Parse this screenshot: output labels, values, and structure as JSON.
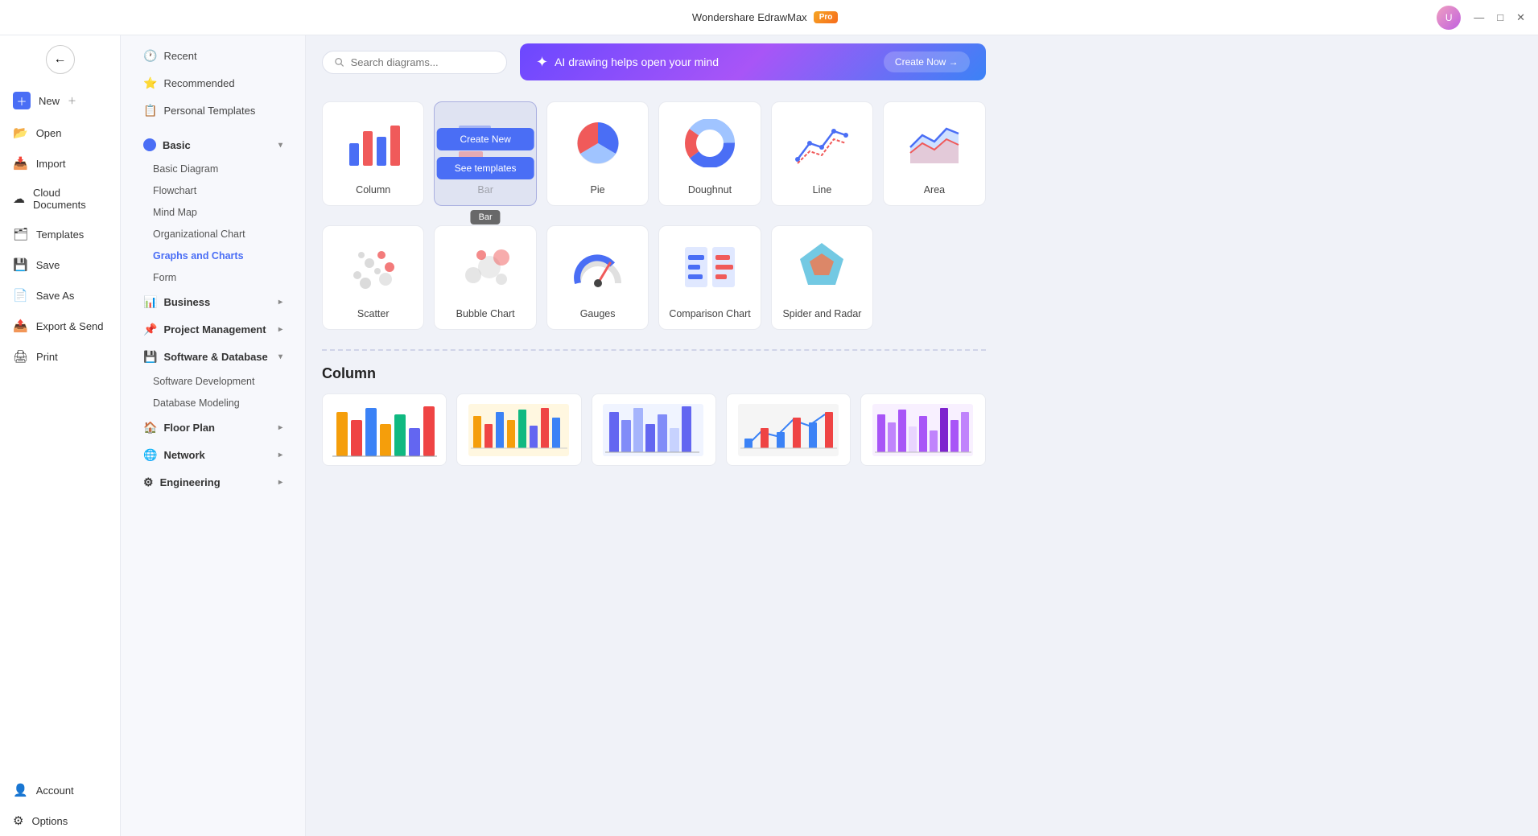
{
  "app": {
    "title": "Wondershare EdrawMax",
    "badge": "Pro"
  },
  "titlebar": {
    "minimize": "—",
    "maximize": "□",
    "close": "✕"
  },
  "search": {
    "placeholder": "Search diagrams..."
  },
  "ai_banner": {
    "icon": "✦",
    "text": "AI drawing helps open your mind",
    "button": "Create Now →"
  },
  "sidebar_narrow": {
    "items": [
      {
        "id": "new",
        "label": "New",
        "icon": "＋"
      },
      {
        "id": "open",
        "label": "Open",
        "icon": "📂"
      },
      {
        "id": "import",
        "label": "Import",
        "icon": "📥"
      },
      {
        "id": "cloud",
        "label": "Cloud Documents",
        "icon": "☁"
      },
      {
        "id": "templates",
        "label": "Templates",
        "icon": "🗂"
      },
      {
        "id": "save",
        "label": "Save",
        "icon": "💾"
      },
      {
        "id": "saveas",
        "label": "Save As",
        "icon": "📄"
      },
      {
        "id": "export",
        "label": "Export & Send",
        "icon": "📤"
      },
      {
        "id": "print",
        "label": "Print",
        "icon": "🖨"
      }
    ],
    "bottom_items": [
      {
        "id": "account",
        "label": "Account",
        "icon": "👤"
      },
      {
        "id": "options",
        "label": "Options",
        "icon": "⚙"
      }
    ]
  },
  "sidebar_wide": {
    "top_items": [
      {
        "id": "recent",
        "label": "Recent",
        "icon": "🕐"
      },
      {
        "id": "recommended",
        "label": "Recommended",
        "icon": "⭐"
      },
      {
        "id": "personal",
        "label": "Personal Templates",
        "icon": "📋"
      }
    ],
    "categories": [
      {
        "id": "basic",
        "label": "Basic",
        "expanded": true,
        "active": false,
        "subitems": [
          {
            "id": "basic-diagram",
            "label": "Basic Diagram",
            "active": false
          },
          {
            "id": "flowchart",
            "label": "Flowchart",
            "active": false
          },
          {
            "id": "mind-map",
            "label": "Mind Map",
            "active": false
          },
          {
            "id": "org-chart",
            "label": "Organizational Chart",
            "active": false
          },
          {
            "id": "graphs-charts",
            "label": "Graphs and Charts",
            "active": true
          },
          {
            "id": "form",
            "label": "Form",
            "active": false
          }
        ]
      },
      {
        "id": "business",
        "label": "Business",
        "expanded": false,
        "subitems": []
      },
      {
        "id": "project",
        "label": "Project Management",
        "expanded": false,
        "subitems": []
      },
      {
        "id": "software-db",
        "label": "Software & Database",
        "expanded": true,
        "active": false,
        "subitems": [
          {
            "id": "sw-dev",
            "label": "Software Development",
            "active": false
          },
          {
            "id": "db-modeling",
            "label": "Database Modeling",
            "active": false
          }
        ]
      },
      {
        "id": "floor-plan",
        "label": "Floor Plan",
        "expanded": false,
        "subitems": []
      },
      {
        "id": "network",
        "label": "Network",
        "expanded": false,
        "subitems": []
      },
      {
        "id": "engineering",
        "label": "Engineering",
        "expanded": false,
        "subitems": []
      }
    ]
  },
  "chart_types": [
    {
      "id": "column",
      "label": "Column",
      "hovered": false
    },
    {
      "id": "bar",
      "label": "Bar",
      "hovered": true
    },
    {
      "id": "pie",
      "label": "Pie",
      "hovered": false
    },
    {
      "id": "doughnut",
      "label": "Doughnut",
      "hovered": false
    },
    {
      "id": "line",
      "label": "Line",
      "hovered": false
    },
    {
      "id": "area",
      "label": "Area",
      "hovered": false
    },
    {
      "id": "scatter",
      "label": "Scatter",
      "hovered": false
    },
    {
      "id": "bubble",
      "label": "Bubble Chart",
      "hovered": false
    },
    {
      "id": "gauges",
      "label": "Gauges",
      "hovered": false
    },
    {
      "id": "comparison",
      "label": "Comparison Chart",
      "hovered": false
    },
    {
      "id": "spider",
      "label": "Spider and Radar",
      "hovered": false
    }
  ],
  "hover_buttons": {
    "create": "Create New",
    "templates": "See templates"
  },
  "bar_tooltip": "Bar",
  "column_section": {
    "title": "Column"
  }
}
